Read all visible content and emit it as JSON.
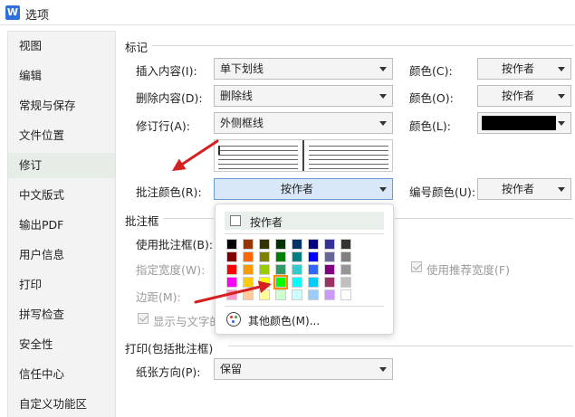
{
  "window": {
    "title": "选项",
    "app_icon": "W"
  },
  "sidebar": {
    "items": [
      {
        "label": "视图"
      },
      {
        "label": "编辑"
      },
      {
        "label": "常规与保存"
      },
      {
        "label": "文件位置"
      },
      {
        "label": "修订"
      },
      {
        "label": "中文版式"
      },
      {
        "label": "输出PDF"
      },
      {
        "label": "用户信息"
      },
      {
        "label": "打印"
      },
      {
        "label": "拼写检查"
      },
      {
        "label": "安全性"
      },
      {
        "label": "信任中心"
      },
      {
        "label": "自定义功能区"
      }
    ],
    "active_index": 4
  },
  "marks": {
    "title": "标记",
    "insert": {
      "label": "插入内容(I):",
      "value": "单下划线",
      "color_label": "颜色(C):",
      "color_value": "按作者"
    },
    "delete": {
      "label": "删除内容(D):",
      "value": "删除线",
      "color_label": "颜色(O):",
      "color_value": "按作者"
    },
    "revised_lines": {
      "label": "修订行(A):",
      "value": "外侧框线",
      "color_label": "颜色(L):",
      "color_swatch": "#000000"
    },
    "comment_color": {
      "label": "批注颜色(R):",
      "value": "按作者"
    },
    "number_color": {
      "label": "编号颜色(U):",
      "value": "按作者"
    }
  },
  "balloons": {
    "title": "批注框",
    "use_balloons_label": "使用批注框(B):",
    "width_label": "指定宽度(W):",
    "recommended_width_label": "使用推荐宽度(F)",
    "margin_label": "边距(M):",
    "show_lines_label": "显示与文字的"
  },
  "print": {
    "title": "打印(包括批注框)",
    "orientation_label": "纸张方向(P):",
    "orientation_value": "保留"
  },
  "color_popup": {
    "auto_label": "按作者",
    "more_colors_label": "其他颜色(M)...",
    "grid": [
      [
        "#000000",
        "#993300",
        "#333300",
        "#003300",
        "#003366",
        "#000080",
        "#333399",
        "#333333"
      ],
      [
        "#800000",
        "#FF6600",
        "#808000",
        "#008000",
        "#008080",
        "#0000FF",
        "#666699",
        "#808080"
      ],
      [
        "#FF0000",
        "#FF9900",
        "#99CC00",
        "#339966",
        "#33CCCC",
        "#3366FF",
        "#800080",
        "#969696"
      ],
      [
        "#FF00FF",
        "#FFCC00",
        "#FFFF00",
        "#00FF00",
        "#00FFFF",
        "#00CCFF",
        "#993366",
        "#C0C0C0"
      ],
      [
        "#FF99CC",
        "#FFCC99",
        "#FFFF99",
        "#CCFFCC",
        "#CCFFFF",
        "#99CCFF",
        "#CC99FF",
        "#FFFFFF"
      ]
    ],
    "selected": {
      "row": 3,
      "col": 3
    }
  },
  "annotations": {
    "arrow_color": "#d42020"
  }
}
